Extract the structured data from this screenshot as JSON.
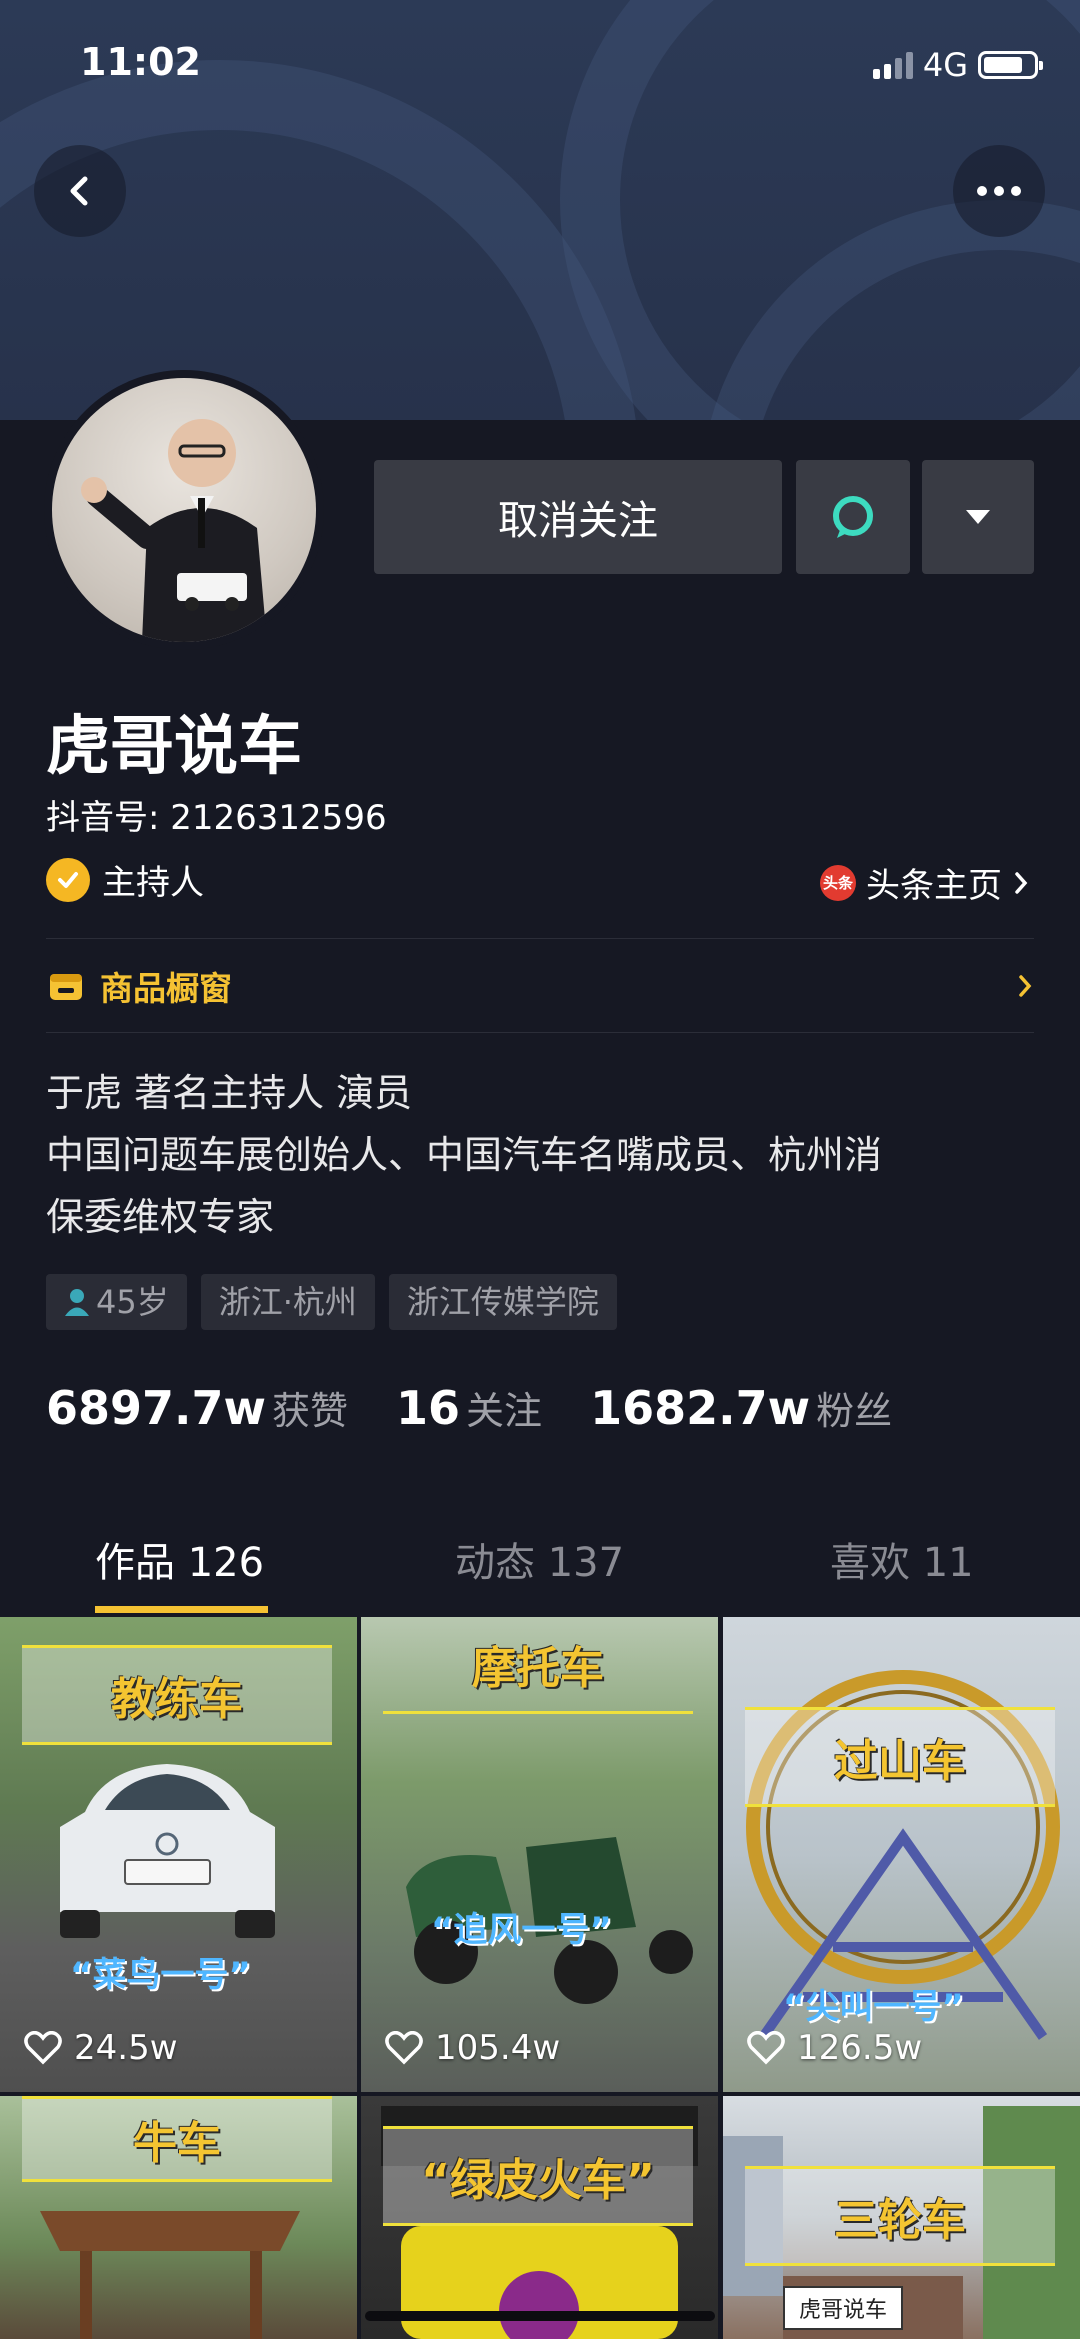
{
  "status_bar": {
    "time": "11:02",
    "network": "4G"
  },
  "profile": {
    "follow_button": "取消关注",
    "name": "虎哥说车",
    "douyin_id": "抖音号: 2126312596",
    "verified_label": "主持人",
    "toutiao_logo_text": "头条",
    "toutiao_link": "头条主页",
    "shop_label": "商品橱窗",
    "bio": [
      "于虎 著名主持人 演员",
      "中国问题车展创始人、中国汽车名嘴成员、杭州消",
      "保委维权专家"
    ],
    "tags": [
      "45岁",
      "浙江·杭州",
      "浙江传媒学院"
    ]
  },
  "stats": [
    {
      "value": "6897.7w",
      "label": "获赞"
    },
    {
      "value": "16",
      "label": "关注"
    },
    {
      "value": "1682.7w",
      "label": "粉丝"
    }
  ],
  "tabs": [
    "作品 126",
    "动态 137",
    "喜欢 11"
  ],
  "videos": [
    {
      "title": "教练车",
      "subtitle": "“菜鸟一号”",
      "likes": "24.5w"
    },
    {
      "title": "摩托车",
      "subtitle": "“追风一号”",
      "likes": "105.4w"
    },
    {
      "title": "过山车",
      "subtitle": "“尖叫一号”",
      "likes": "126.5w"
    },
    {
      "title": "牛车",
      "subtitle": "",
      "likes": ""
    },
    {
      "title": "“绿皮火车”",
      "subtitle": "",
      "likes": ""
    },
    {
      "title": "三轮车",
      "subtitle": "",
      "likes": ""
    }
  ],
  "plate_text": "虎哥说车",
  "colors": {
    "background": "#161823",
    "accent": "#f5c233",
    "button": "#393b44"
  }
}
